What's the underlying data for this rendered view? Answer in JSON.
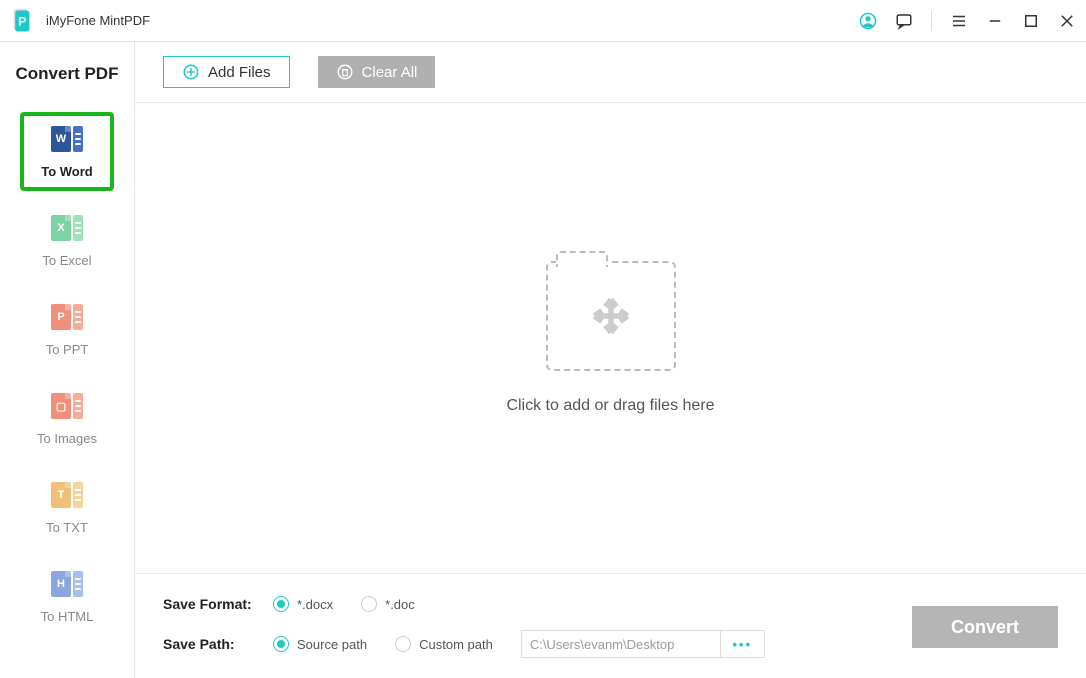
{
  "app": {
    "title": "iMyFone MintPDF"
  },
  "sidebar": {
    "title": "Convert PDF",
    "items": [
      {
        "label": "To Word",
        "letter": "W",
        "selected": true,
        "color": "word"
      },
      {
        "label": "To Excel",
        "letter": "X",
        "selected": false,
        "color": "excel"
      },
      {
        "label": "To PPT",
        "letter": "P",
        "selected": false,
        "color": "ppt"
      },
      {
        "label": "To Images",
        "letter": "▢",
        "selected": false,
        "color": "img"
      },
      {
        "label": "To TXT",
        "letter": "T",
        "selected": false,
        "color": "txt"
      },
      {
        "label": "To HTML",
        "letter": "H",
        "selected": false,
        "color": "html"
      }
    ]
  },
  "toolbar": {
    "add_files_label": "Add Files",
    "clear_all_label": "Clear All"
  },
  "dropzone": {
    "text": "Click to add or drag files here"
  },
  "bottom": {
    "save_format_label": "Save Format:",
    "save_path_label": "Save Path:",
    "format_options": [
      {
        "label": "*.docx",
        "selected": true
      },
      {
        "label": "*.doc",
        "selected": false
      }
    ],
    "path_options": [
      {
        "label": "Source path",
        "selected": true
      },
      {
        "label": "Custom path",
        "selected": false
      }
    ],
    "path_value": "C:\\Users\\evanm\\Desktop",
    "convert_label": "Convert"
  },
  "colors": {
    "accent": "#1ec8c8",
    "selected_border": "#18b718",
    "disabled": "#b0b0b0"
  }
}
